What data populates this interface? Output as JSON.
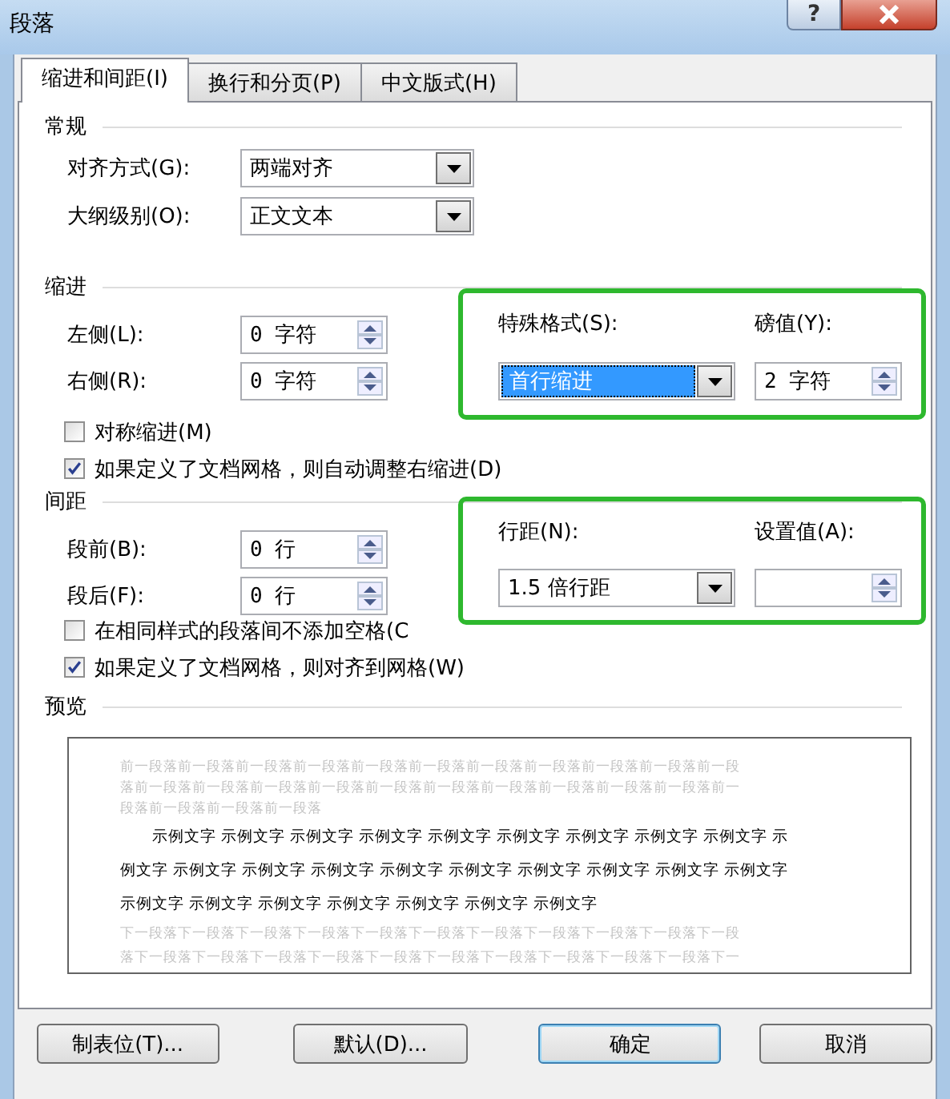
{
  "window": {
    "title": "段落",
    "help": "?"
  },
  "tabs": [
    {
      "label": "缩进和间距(I)",
      "selected": true
    },
    {
      "label": "换行和分页(P)",
      "selected": false
    },
    {
      "label": "中文版式(H)",
      "selected": false
    }
  ],
  "general": {
    "heading": "常规",
    "fields": [
      {
        "label": "对齐方式(G):",
        "value": "两端对齐",
        "focused": false
      },
      {
        "label": "大纲级别(O):",
        "value": "正文文本",
        "focused": false
      }
    ]
  },
  "indent": {
    "heading": "缩进",
    "fields": [
      {
        "label": "左侧(L):",
        "value": "0 字符"
      },
      {
        "label": "右侧(R):",
        "value": "0 字符"
      }
    ],
    "highlighted": true,
    "combo": {
      "label": "特殊格式(S):",
      "value": "首行缩进",
      "focused": true
    },
    "spin": {
      "label": "磅值(Y):",
      "value": "2 字符"
    },
    "checks": [
      {
        "label": "对称缩进(M)",
        "checked": false
      },
      {
        "label": "如果定义了文档网格，则自动调整右缩进(D)",
        "checked": true
      }
    ]
  },
  "spacing": {
    "heading": "间距",
    "fields": [
      {
        "label": "段前(B):",
        "value": "0 行"
      },
      {
        "label": "段后(F):",
        "value": "0 行"
      }
    ],
    "highlighted": true,
    "combo": {
      "label": "行距(N):",
      "value": "1.5 倍行距",
      "focused": false
    },
    "spin": {
      "label": "设置值(A):"
    },
    "checks": [
      {
        "label": "在相同样式的段落间不添加空格(C",
        "checked": false
      },
      {
        "label": "如果定义了文档网格，则对齐到网格(W)",
        "checked": true
      }
    ]
  },
  "preview": {
    "heading": "预览",
    "lines": [
      {
        "kind": "before",
        "text": "前一段落前一段落前一段落前一段落前一段落前一段落前一段落前一段落前一段落前一段落前一段"
      },
      {
        "kind": "before",
        "text": "落前一段落前一段落前一段落前一段落前一段落前一段落前一段落前一段落前一段落前一段落前一"
      },
      {
        "kind": "before",
        "text": "段落前一段落前一段落前一段落"
      },
      {
        "kind": "sample",
        "text": "示例文字 示例文字 示例文字 示例文字 示例文字 示例文字 示例文字 示例文字 示例文字 示"
      },
      {
        "kind": "sample",
        "text": "例文字 示例文字 示例文字 示例文字 示例文字 示例文字 示例文字 示例文字 示例文字 示例文字"
      },
      {
        "kind": "sample",
        "text": "示例文字 示例文字 示例文字 示例文字 示例文字 示例文字 示例文字"
      },
      {
        "kind": "after",
        "text": "下一段落下一段落下一段落下一段落下一段落下一段落下一段落下一段落下一段落下一段落下一段"
      },
      {
        "kind": "after",
        "text": "落下一段落下一段落下一段落下一段落下一段落下一段落下一段落下一段落下一段落下一段落下一"
      }
    ]
  },
  "buttons": [
    {
      "label": "制表位(T)...",
      "default": false
    },
    {
      "label": "默认(D)...",
      "default": false
    },
    {
      "label": "确定",
      "default": true
    },
    {
      "label": "取消",
      "default": false
    }
  ]
}
